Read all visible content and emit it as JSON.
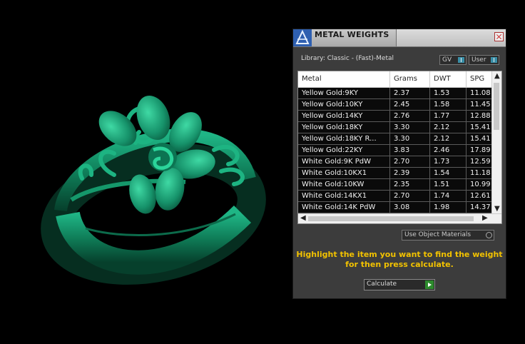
{
  "colors": {
    "ring": "#1fa57a",
    "panel_bg": "#3c3c3c",
    "hint": "#f2c200",
    "calc_accent": "#2d8a2d"
  },
  "viewport": {
    "object": "ring-model"
  },
  "panel": {
    "logo_icon": "rhino-jewel-logo-icon",
    "title": "METAL WEIGHTS",
    "library_label": "Library: Classic - (Fast)-Metal",
    "toggle_gv": "GV",
    "toggle_user": "User",
    "table": {
      "headers": [
        "Metal",
        "Grams",
        "DWT",
        "SPG"
      ],
      "rows": [
        [
          "Yellow Gold:9KY",
          "2.37",
          "1.53",
          "11.08"
        ],
        [
          "Yellow Gold:10KY",
          "2.45",
          "1.58",
          "11.45"
        ],
        [
          "Yellow Gold:14KY",
          "2.76",
          "1.77",
          "12.88"
        ],
        [
          "Yellow Gold:18KY",
          "3.30",
          "2.12",
          "15.41"
        ],
        [
          "Yellow Gold:18KY R...",
          "3.30",
          "2.12",
          "15.41"
        ],
        [
          "Yellow Gold:22KY",
          "3.83",
          "2.46",
          "17.89"
        ],
        [
          "White Gold:9K PdW",
          "2.70",
          "1.73",
          "12.59"
        ],
        [
          "White Gold:10KX1",
          "2.39",
          "1.54",
          "11.18"
        ],
        [
          "White Gold:10KW",
          "2.35",
          "1.51",
          "10.99"
        ],
        [
          "White Gold:14KX1",
          "2.70",
          "1.74",
          "12.61"
        ],
        [
          "White Gold:14K PdW",
          "3.08",
          "1.98",
          "14.37"
        ]
      ]
    },
    "use_object_materials": "Use Object Materials",
    "hint_line1": "Highlight the item you want to find the weight",
    "hint_line2": "for then press calculate.",
    "calculate_label": "Calculate"
  }
}
